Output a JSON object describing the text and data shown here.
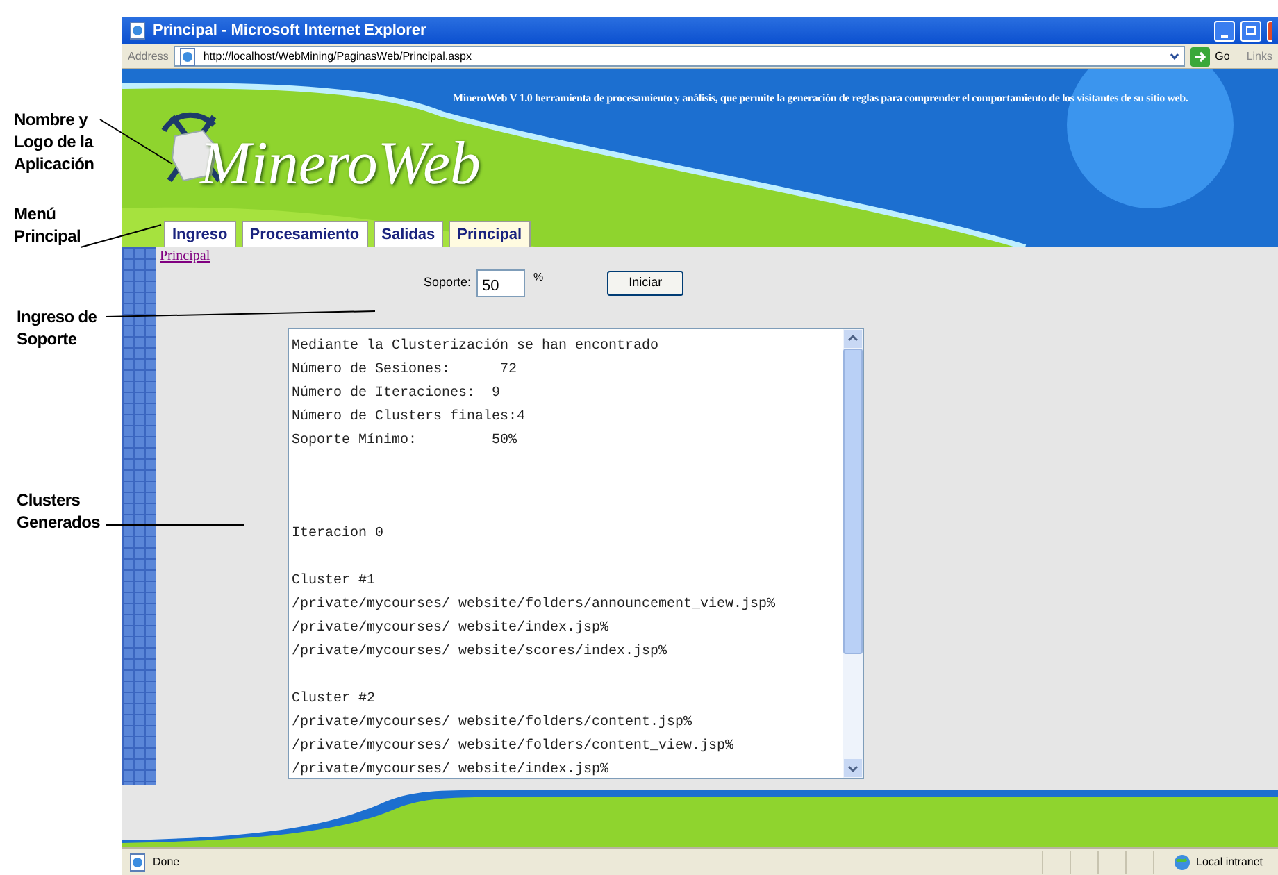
{
  "annotations": [
    {
      "lines": [
        "Nombre y",
        "Logo de la",
        "Aplicación"
      ]
    },
    {
      "lines": [
        "Menú",
        "Principal"
      ]
    },
    {
      "lines": [
        "Ingreso de",
        "Soporte"
      ]
    },
    {
      "lines": [
        "Clusters",
        "Generados"
      ]
    }
  ],
  "window": {
    "title": "Principal - Microsoft Internet Explorer"
  },
  "address_bar": {
    "label": "Address",
    "url": "http://localhost/WebMining/PaginasWeb/Principal.aspx",
    "go": "Go",
    "links": "Links"
  },
  "banner": {
    "tagline": "MineroWeb V 1.0 herramienta de procesamiento y análisis, que permite la generación de reglas para comprender el comportamiento de los visitantes de su sitio web.",
    "app_name": "MineroWeb"
  },
  "tabs": [
    {
      "label": "Ingreso",
      "selected": false
    },
    {
      "label": "Procesamiento",
      "selected": false
    },
    {
      "label": "Salidas",
      "selected": false
    },
    {
      "label": "Principal",
      "selected": true
    }
  ],
  "breadcrumb": "Principal",
  "support": {
    "label": "Soporte:",
    "value": "50",
    "unit": "%",
    "button": "Iniciar"
  },
  "output": [
    {
      "kind": "summary",
      "lines": [
        "Mediante la Clusterización se han encontrado",
        "Número de Sesiones:      72",
        "Número de Iteraciones:  9",
        "Número de Clusters finales:4",
        "Soporte Mínimo:         50%"
      ]
    },
    {
      "kind": "iteration",
      "lines": [
        "Iteracion 0"
      ]
    },
    {
      "kind": "cluster",
      "lines": [
        "Cluster #1",
        "/private/mycourses/ website/folders/announcement_view.jsp%",
        "/private/mycourses/ website/index.jsp%",
        "/private/mycourses/ website/scores/index.jsp%"
      ]
    },
    {
      "kind": "cluster",
      "lines": [
        "Cluster #2",
        "/private/mycourses/ website/folders/content.jsp%",
        "/private/mycourses/ website/folders/content_view.jsp%",
        "/private/mycourses/ website/index.jsp%"
      ]
    }
  ],
  "status_bar": {
    "status": "Done",
    "zone": "Local intranet"
  }
}
